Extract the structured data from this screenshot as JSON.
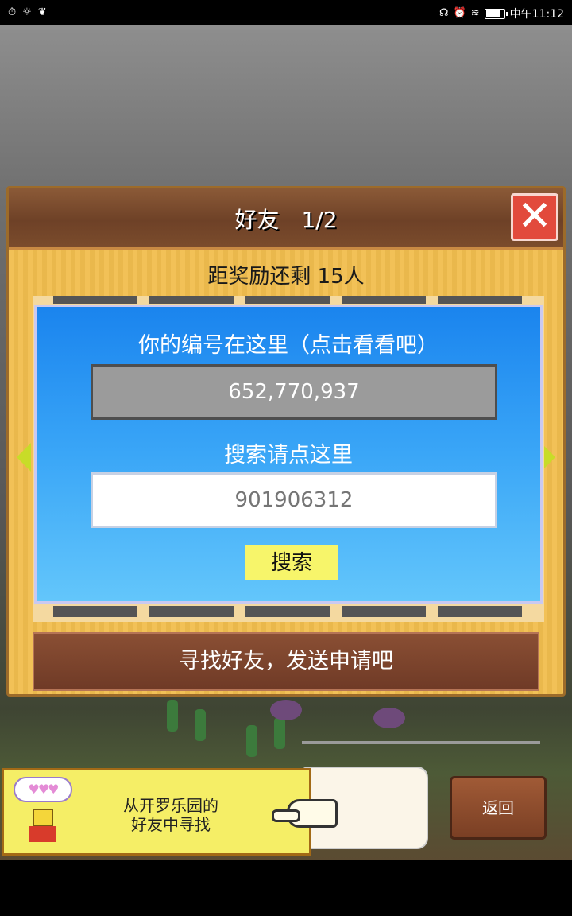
{
  "status_bar": {
    "left_icons": [
      "timer-icon",
      "sun-icon",
      "game-app-icon"
    ],
    "right_icons": [
      "headphones-icon",
      "alarm-icon",
      "wifi-icon",
      "battery-icon"
    ],
    "time": "中午11:12",
    "battery_level": 0.75
  },
  "panel": {
    "title": "好友　1/2",
    "close_icon": "close-icon",
    "reward_text": "距奖励还剩 15人",
    "id_label": "你的编号在这里（点击看看吧）",
    "id_value": "652,770,937",
    "search_label": "搜索请点这里",
    "search_placeholder": "901906312",
    "search_button": "搜索",
    "find_friends_button": "寻找好友，发送申请吧"
  },
  "hint": {
    "text_line1": "从开罗乐园的",
    "text_line2": "好友中寻找",
    "hearts": "♥♥♥"
  },
  "back_button": "返回",
  "colors": {
    "panel_bg": "#f1be4e",
    "header_brown": "#6e4127",
    "blue_box": "#3aa6f7",
    "search_button": "#f7f56a",
    "close_red": "#e24a3c",
    "arrow_green": "#c8dc28"
  }
}
